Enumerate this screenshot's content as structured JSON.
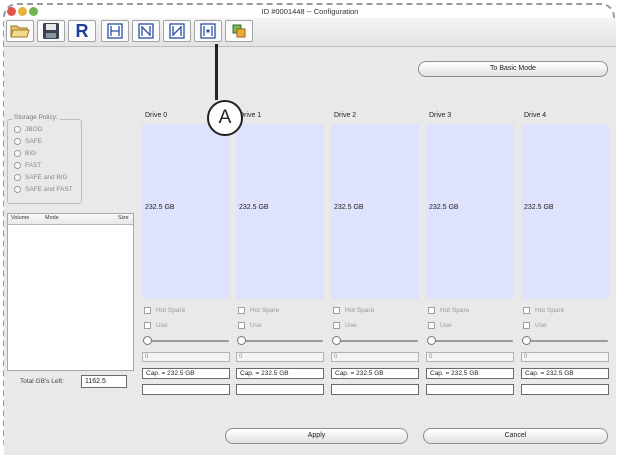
{
  "window": {
    "title": "ID #0001448 -- Configuration"
  },
  "toolbar": {
    "items": [
      {
        "name": "open-folder-icon"
      },
      {
        "name": "save-disk-icon"
      },
      {
        "name": "r-icon",
        "label": "R"
      },
      {
        "name": "raid-layout-1-icon"
      },
      {
        "name": "raid-layout-2-icon"
      },
      {
        "name": "raid-layout-3-icon"
      },
      {
        "name": "raid-layout-4-icon"
      },
      {
        "name": "raid-layout-5-icon"
      }
    ]
  },
  "basic_mode_button": "To Basic Mode",
  "storage_policy": {
    "legend": "Storage Policy:",
    "options": [
      "JBOD",
      "SAFE",
      "BIG",
      "FAST",
      "SAFE and BIG",
      "SAFE and FAST"
    ]
  },
  "volume_table": {
    "columns": [
      "Volume",
      "Mode",
      "Size"
    ]
  },
  "total_left": {
    "label": "Total GB's Left:",
    "value": "1162.5"
  },
  "drives": [
    {
      "title": "Drive 0",
      "size": "232.5 GB",
      "hot_spare": "Hot Spare",
      "use": "Use",
      "value": "0",
      "capacity": "Cap. = 232.5 GB"
    },
    {
      "title": "Drive 1",
      "size": "232.5 GB",
      "hot_spare": "Hot Spare",
      "use": "Use",
      "value": "0",
      "capacity": "Cap. = 232.5 GB"
    },
    {
      "title": "Drive 2",
      "size": "232.5 GB",
      "hot_spare": "Hot Spare",
      "use": "Use",
      "value": "0",
      "capacity": "Cap. = 232.5 GB"
    },
    {
      "title": "Drive 3",
      "size": "232.5 GB",
      "hot_spare": "Hot Spare",
      "use": "Use",
      "value": "0",
      "capacity": "Cap. = 232.5 GB"
    },
    {
      "title": "Drive 4",
      "size": "232.5 GB",
      "hot_spare": "Hot Spare",
      "use": "Use",
      "value": "0",
      "capacity": "Cap. = 232.5 GB"
    }
  ],
  "apply_button": "Apply",
  "cancel_button": "Cancel",
  "callout_label": "A",
  "colors": {
    "drive_area": "#dfe2fc",
    "window_bg": "#e9e9e9",
    "close_button": "#e2554b",
    "minimize_button": "#e7b43a",
    "zoom_button": "#6cb64d"
  }
}
